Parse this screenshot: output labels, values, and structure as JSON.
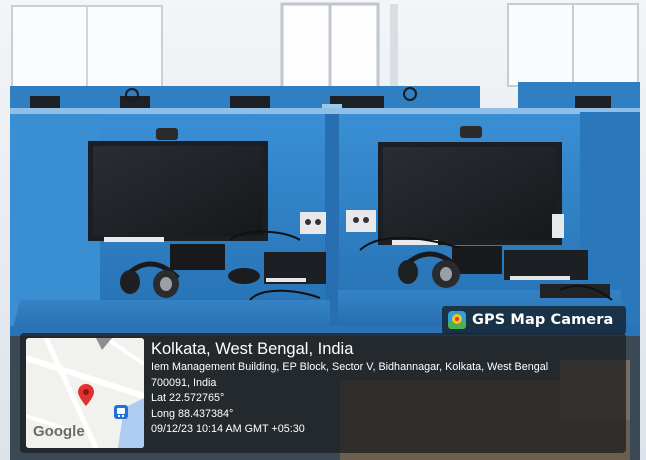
{
  "photo": {
    "subject": "computer-lab-cubicles",
    "colors": {
      "cubicle": "#2f7fc2",
      "desk": "#2c73b5",
      "monitor": "#1b1e22"
    }
  },
  "watermark": {
    "badge_icon": "gps-map-camera-icon",
    "badge_label": "GPS Map Camera",
    "map_logo": "Google",
    "map_pin_icon": "map-pin-icon",
    "transit_icon": "bus-stop-icon",
    "title": "Kolkata, West Bengal, India",
    "address_line1": "Iem Management Building, EP Block, Sector V, Bidhannagar, Kolkata, West Bengal",
    "address_line2": "700091, India",
    "lat": "Lat 22.572765°",
    "long": "Long 88.437384°",
    "datetime": "09/12/23 10:14 AM GMT +05:30"
  }
}
